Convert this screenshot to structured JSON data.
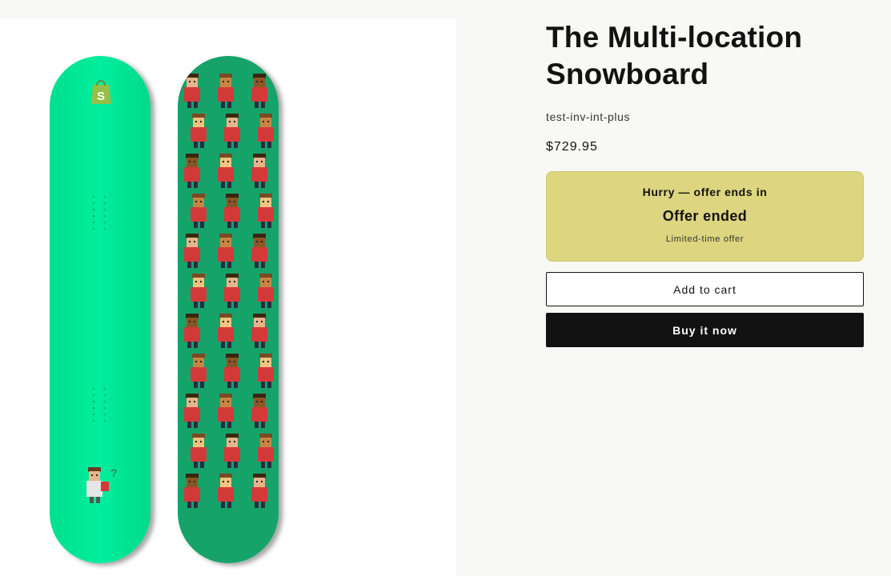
{
  "product": {
    "title": "The Multi-location Snowboard",
    "vendor": "test-inv-int-plus",
    "price": "$729.95",
    "image_description": "Two snowboards: solid mint green base and green top with pixel-art characters"
  },
  "offer": {
    "hurry": "Hurry — offer ends in",
    "status": "Offer ended",
    "note": "Limited-time offer"
  },
  "buttons": {
    "add_to_cart": "Add to cart",
    "buy_now": "Buy it now"
  },
  "colors": {
    "page_background": "#f8f8f6",
    "offer_background": "#ddd57f",
    "board_base": "#00eb97",
    "board_top": "#13a36b",
    "buy_button": "#121212"
  },
  "icons": {
    "logo": "shopify-bag-icon",
    "figure": "pixel-character-icon"
  }
}
